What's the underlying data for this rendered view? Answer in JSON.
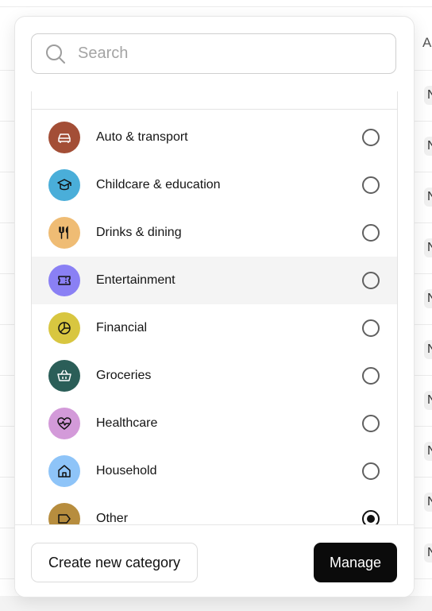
{
  "background": {
    "column_header": "A",
    "row_chip_text": "N"
  },
  "search": {
    "placeholder": "Search",
    "value": ""
  },
  "categories": [
    {
      "label": "Auto & transport",
      "icon": "car-icon",
      "color": "#a34e36",
      "selected": false
    },
    {
      "label": "Childcare & education",
      "icon": "graduation-cap-icon",
      "color": "#4aaed9",
      "selected": false
    },
    {
      "label": "Drinks & dining",
      "icon": "fork-knife-icon",
      "color": "#efbc74",
      "selected": false
    },
    {
      "label": "Entertainment",
      "icon": "ticket-icon",
      "color": "#8a80f4",
      "selected": false,
      "hovered": true
    },
    {
      "label": "Financial",
      "icon": "pie-chart-icon",
      "color": "#d8c640",
      "selected": false
    },
    {
      "label": "Groceries",
      "icon": "basket-icon",
      "color": "#2b5e58",
      "selected": false
    },
    {
      "label": "Healthcare",
      "icon": "heart-pulse-icon",
      "color": "#d39ad9",
      "selected": false
    },
    {
      "label": "Household",
      "icon": "house-icon",
      "color": "#8ec4f8",
      "selected": false
    },
    {
      "label": "Other",
      "icon": "tag-icon",
      "color": "#b78d3e",
      "selected": true
    }
  ],
  "footer": {
    "create_label": "Create new category",
    "manage_label": "Manage"
  }
}
